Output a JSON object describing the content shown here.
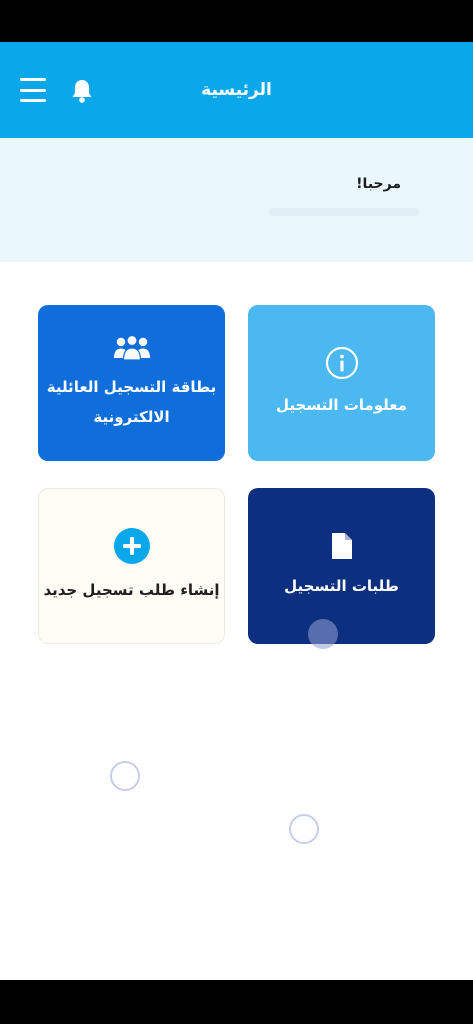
{
  "header": {
    "title": "الرئيسية",
    "menu_icon": "hamburger-menu-icon",
    "bell_icon": "bell-icon"
  },
  "welcome": {
    "greeting": "مرحبا!"
  },
  "tiles": {
    "info": {
      "label": "معلومات التسجيل",
      "icon": "info-icon",
      "color": "#4cb8f2"
    },
    "family_card": {
      "label_line1": "بطاقة التسجيل العائلية",
      "label_line2": "الالكترونية",
      "icon": "family-group-icon",
      "color": "#0f6ed9"
    },
    "requests": {
      "label": "طلبات التسجيل",
      "icon": "document-icon",
      "color": "#0c2f80"
    },
    "new_request": {
      "label": "إنشاء طلب تسجيل جديد",
      "icon": "plus-circle-icon",
      "color": "#fdfcf5"
    }
  },
  "colors": {
    "header": "#0aa8ea",
    "welcome_bg": "#e9f6fc"
  }
}
